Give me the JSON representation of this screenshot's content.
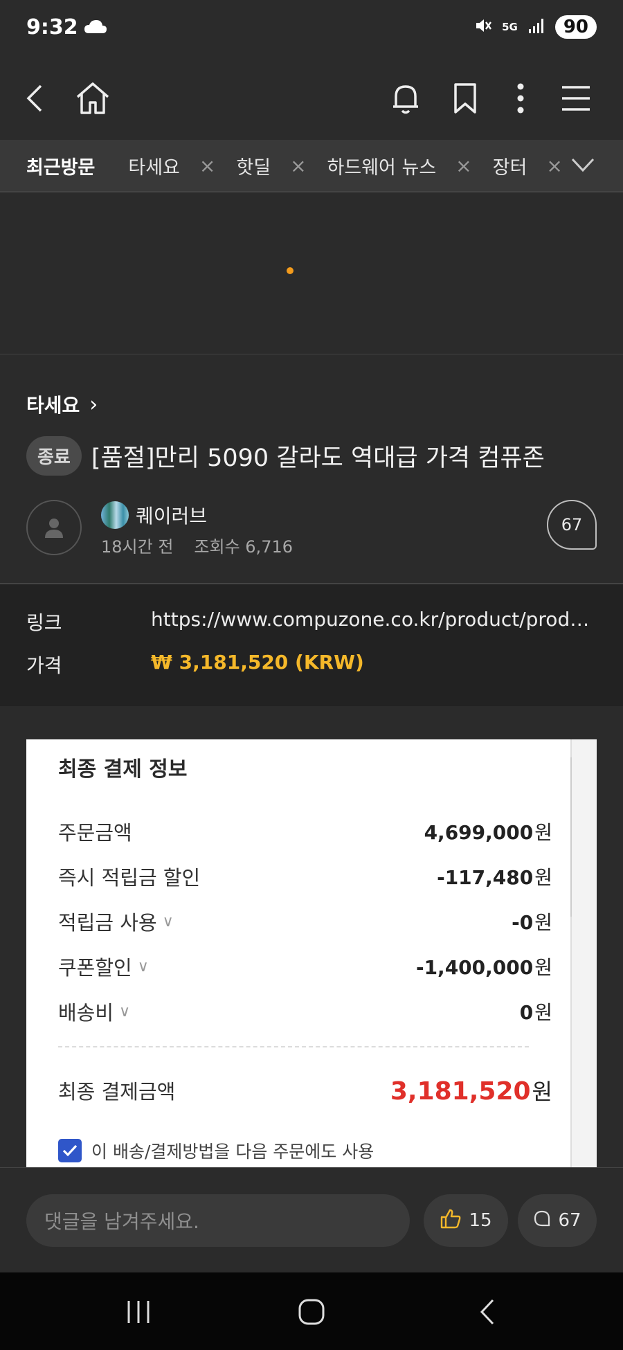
{
  "status_bar": {
    "time": "9:32",
    "network": "5G",
    "battery": "90"
  },
  "top_nav": {
    "back_icon": "back-arrow-icon",
    "home_icon": "home-icon",
    "bell_icon": "bell-icon",
    "bookmark_icon": "bookmark-icon",
    "more_icon": "more-vertical-icon",
    "menu_icon": "hamburger-menu-icon"
  },
  "recent_tabs": {
    "label": "최근방문",
    "items": [
      {
        "label": "타세요",
        "close": "×"
      },
      {
        "label": "핫딜",
        "close": "×"
      },
      {
        "label": "하드웨어 뉴스",
        "close": "×"
      },
      {
        "label": "장터",
        "close": "×"
      }
    ]
  },
  "post": {
    "board": "타세요",
    "board_chevron": "›",
    "badge": "종료",
    "title": "[품절]만리 5090 갈라도 역대급 가격 컴퓨존",
    "author": "퀘이러브",
    "time_ago": "18시간 전",
    "views": "조회수 6,716",
    "comment_count": "67"
  },
  "deal_info": {
    "link_label": "링크",
    "link_value": "https://www.compuzone.co.kr/product/product_detail.htm",
    "price_label": "가격",
    "price_value": "₩ 3,181,520 (KRW)"
  },
  "screenshot": {
    "title": "최종 결제 정보",
    "rows": [
      {
        "label": "주문금액",
        "value": "4,699,000",
        "unit": "원",
        "chevron": ""
      },
      {
        "label": "즉시 적립금 할인",
        "value": "-117,480",
        "unit": "원",
        "chevron": ""
      },
      {
        "label": "적립금 사용",
        "value": "-0",
        "unit": "원",
        "chevron": "∨"
      },
      {
        "label": "쿠폰할인",
        "value": "-1,400,000",
        "unit": "원",
        "chevron": "∨"
      },
      {
        "label": "배송비",
        "value": "0",
        "unit": "원",
        "chevron": "∨"
      }
    ],
    "total_label": "최종 결제금액",
    "total_value": "3,181,520",
    "total_unit": "원",
    "checkbox_label": "이 배송/결제방법을 다음 주문에도 사용",
    "checkbox_checked": true
  },
  "bottom_bar": {
    "comment_placeholder": "댓글을 남겨주세요.",
    "likes": "15",
    "comments": "67"
  },
  "colors": {
    "background": "#2b2b2b",
    "price": "#f5b82a",
    "total_red": "#e0302a",
    "checkbox_blue": "#2f56c9",
    "loading_dot": "#f39b1c"
  }
}
